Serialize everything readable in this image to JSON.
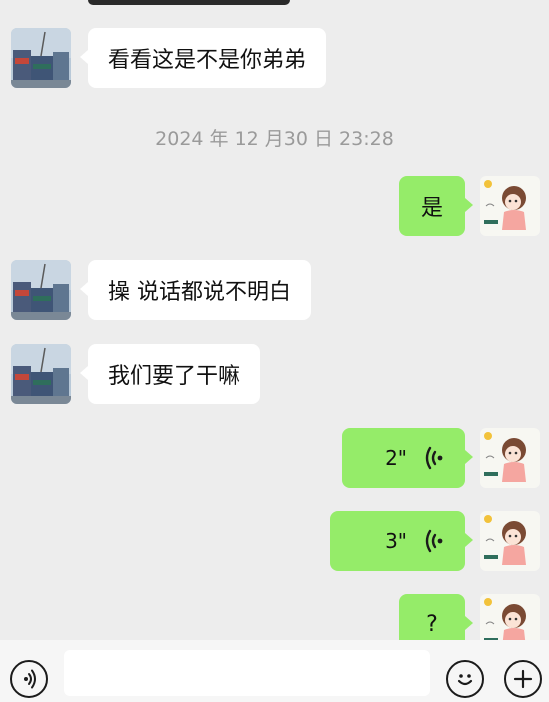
{
  "messages": [
    {
      "side": "in",
      "type": "text",
      "text": "看看这是不是你弟弟"
    },
    {
      "type": "timestamp",
      "text": "2024 年 12 月30 日 23:28"
    },
    {
      "side": "out",
      "type": "text",
      "text": "是"
    },
    {
      "side": "in",
      "type": "text",
      "text": "操 说话都说不明白"
    },
    {
      "side": "in",
      "type": "text",
      "text": "我们要了干嘛"
    },
    {
      "side": "out",
      "type": "voice",
      "duration": "2\""
    },
    {
      "side": "out",
      "type": "voice",
      "duration": "3\""
    },
    {
      "side": "out",
      "type": "text",
      "text": "?"
    }
  ],
  "icons": {
    "voice_toggle": "voice-mode-icon",
    "emoji": "emoji-icon",
    "more": "plus-icon",
    "voice_wave": "voice-wave-icon"
  },
  "colors": {
    "background": "#ededed",
    "incoming_bubble": "#ffffff",
    "outgoing_bubble": "#95ec69",
    "timestamp_text": "#9a9a9a"
  }
}
